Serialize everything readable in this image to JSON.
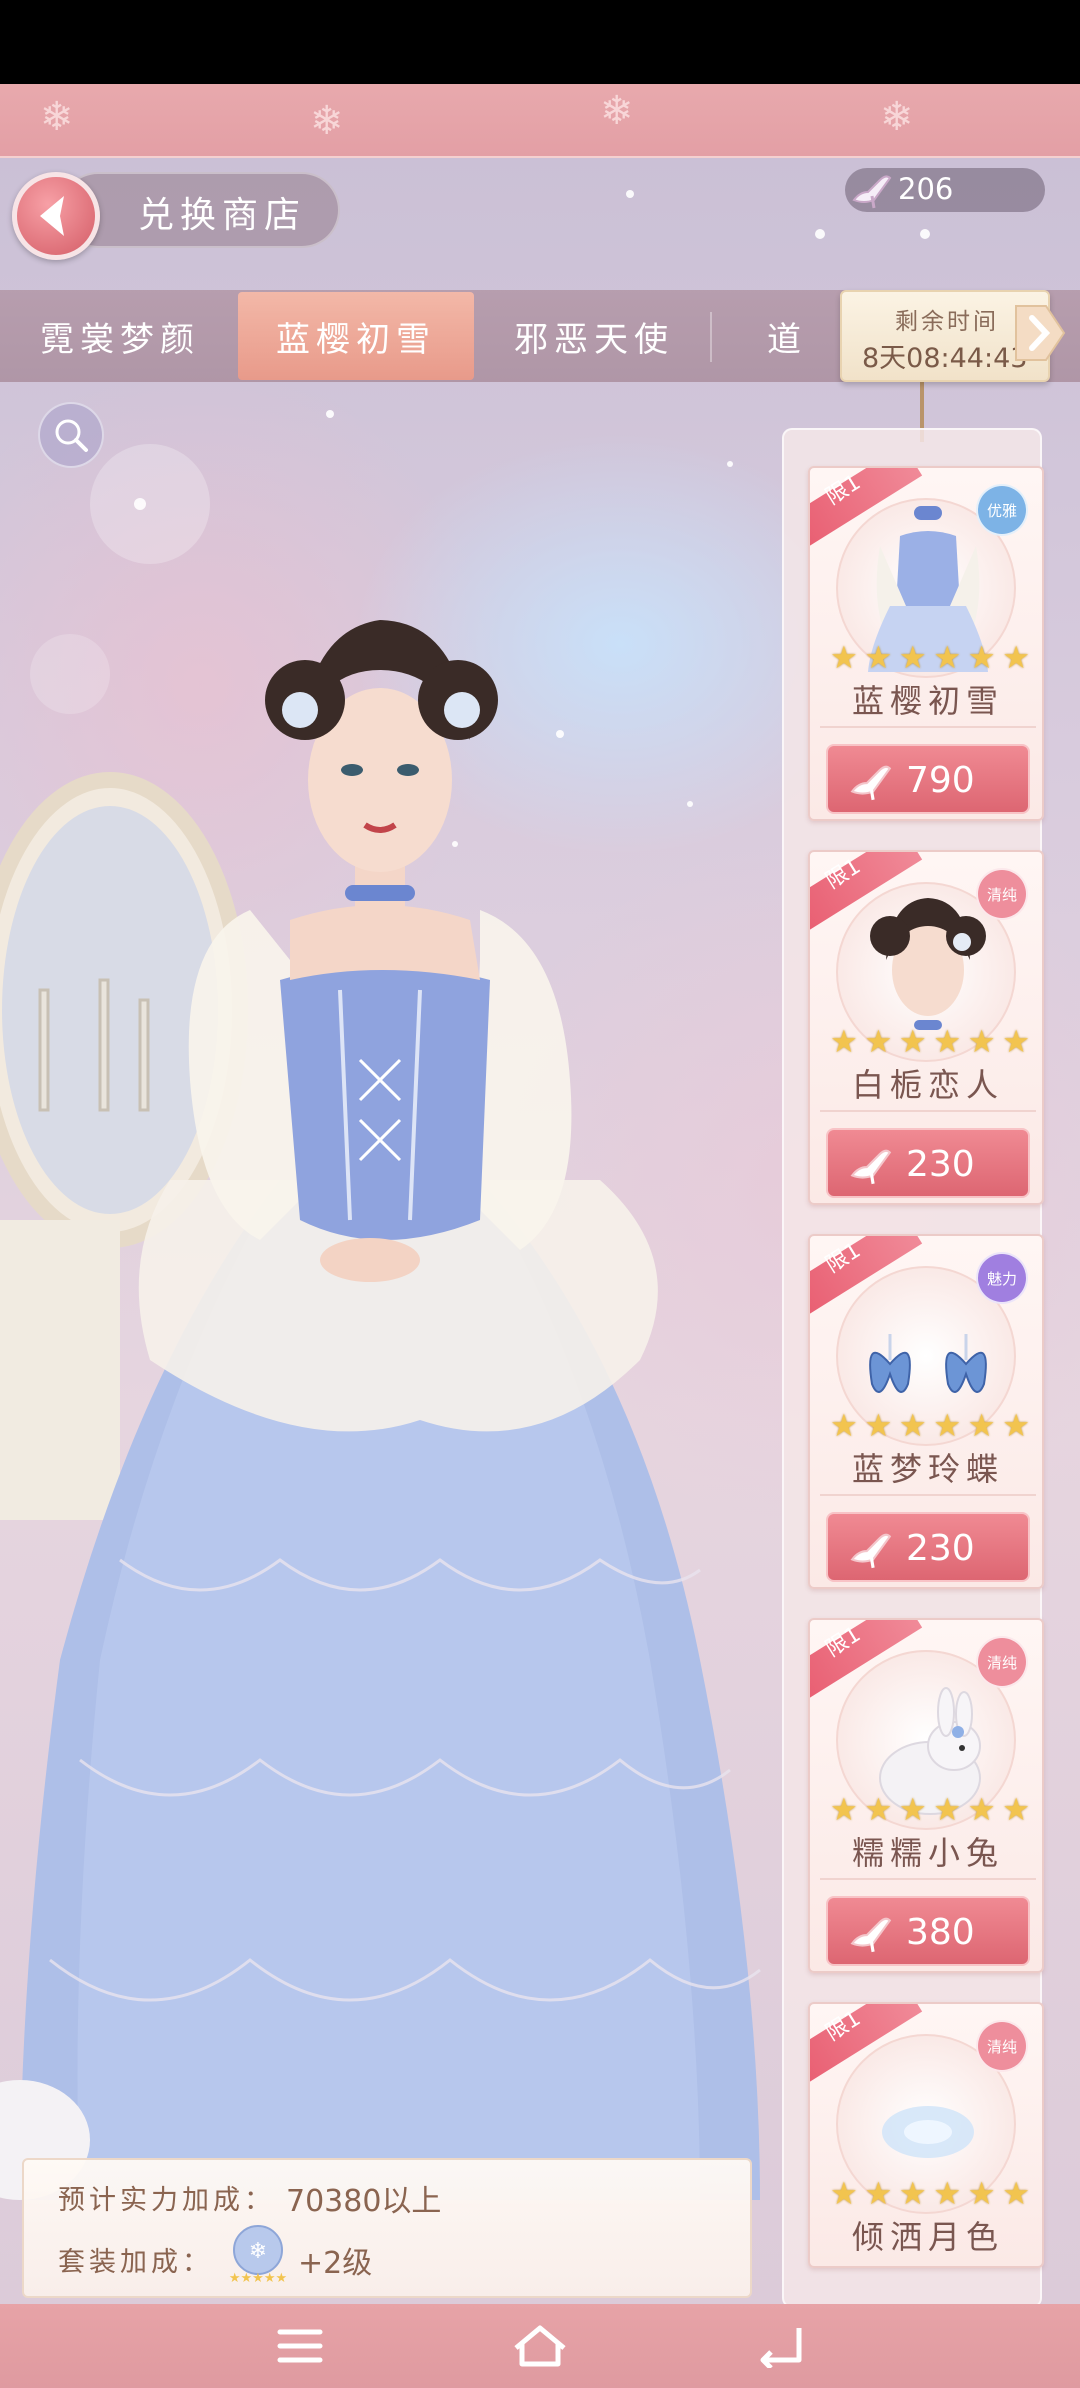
{
  "header": {
    "title": "兑换商店",
    "currency_value": "206"
  },
  "tabs": [
    {
      "label": "霓裳梦颜",
      "active": false
    },
    {
      "label": "蓝樱初雪",
      "active": true
    },
    {
      "label": "邪恶天使",
      "active": false
    },
    {
      "label": "道",
      "active": false
    }
  ],
  "timer": {
    "label": "剩余时间",
    "value": "8天08:44:43"
  },
  "cards": [
    {
      "limit": "限1",
      "badge": "优雅",
      "badge_color": "#7db3e6",
      "stars": 6,
      "name": "蓝樱初雪",
      "price": "790",
      "item_icon": "dress-icon"
    },
    {
      "limit": "限1",
      "badge": "清纯",
      "badge_color": "#ee8e9c",
      "stars": 6,
      "name": "白栀恋人",
      "price": "230",
      "item_icon": "hairstyle-icon"
    },
    {
      "limit": "限1",
      "badge": "魅力",
      "badge_color": "#a07fe0",
      "stars": 6,
      "name": "蓝梦玲蝶",
      "price": "230",
      "item_icon": "butterfly-earrings-icon"
    },
    {
      "limit": "限1",
      "badge": "清纯",
      "badge_color": "#ee8e9c",
      "stars": 6,
      "name": "糯糯小兔",
      "price": "380",
      "item_icon": "bunny-icon"
    },
    {
      "limit": "限1",
      "badge": "清纯",
      "badge_color": "#ee8e9c",
      "stars": 6,
      "name": "倾洒月色",
      "price": "",
      "item_icon": "moonlight-effect-icon"
    }
  ],
  "bonus": {
    "power_label": "预计实力加成：",
    "power_value": "70380以上",
    "set_label": "套装加成：",
    "set_value": "+2级"
  },
  "colors": {
    "accent": "#dd6672",
    "band": "#e39fa5",
    "gold_star": "#f2c44f"
  }
}
